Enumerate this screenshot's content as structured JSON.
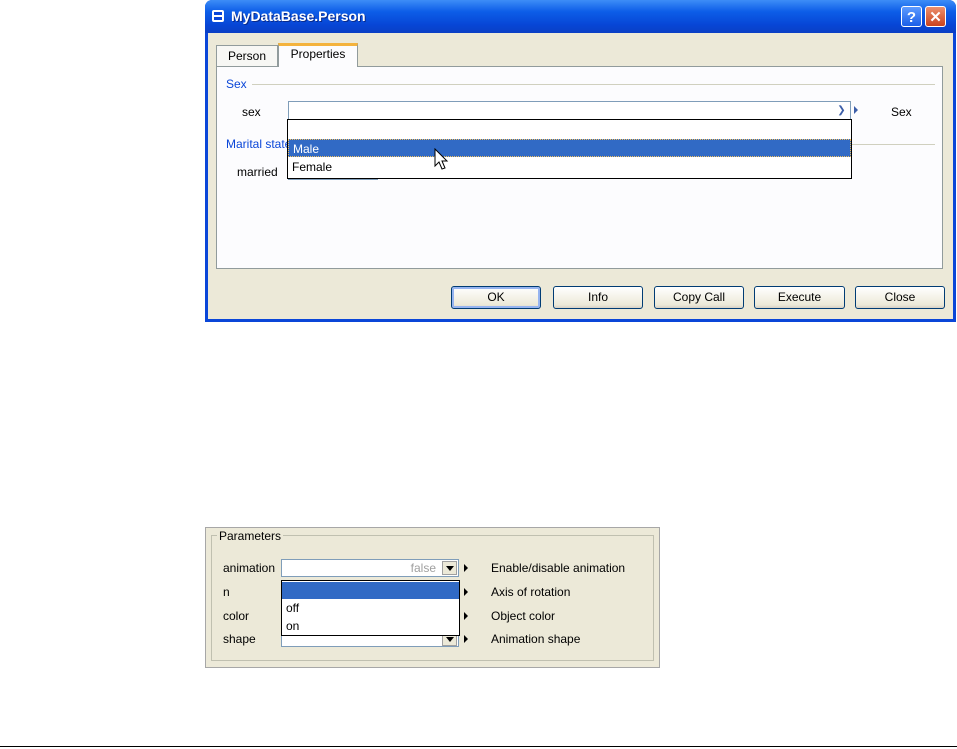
{
  "dialog": {
    "title": "MyDataBase.Person",
    "help_label": "?",
    "close_label": "✕",
    "tabs": [
      {
        "label": "Person"
      },
      {
        "label": "Properties"
      }
    ],
    "sex_group": {
      "title": "Sex",
      "field_label": "sex",
      "value": "",
      "description": "Sex",
      "options": [
        "",
        "Male",
        "Female"
      ],
      "highlighted": "Male"
    },
    "marital_group": {
      "title": "Marital state",
      "field_label": "married"
    },
    "buttons": {
      "ok": "OK",
      "info": "Info",
      "copy_call": "Copy Call",
      "execute": "Execute",
      "close": "Close"
    }
  },
  "parameters": {
    "title": "Parameters",
    "rows": [
      {
        "label": "animation",
        "value": "false",
        "description": "Enable/disable animation"
      },
      {
        "label": "n",
        "value": "",
        "description": "Axis of rotation"
      },
      {
        "label": "color",
        "value": "",
        "description": "Object color"
      },
      {
        "label": "shape",
        "value": "",
        "description": "Animation shape"
      }
    ],
    "dropdown_options": [
      "",
      "off",
      "on"
    ]
  },
  "colors": {
    "title_bar": "#0a46d8",
    "selection": "#316ac5",
    "group_title": "#0a46d8",
    "active_tab_accent": "#f4b33d"
  }
}
